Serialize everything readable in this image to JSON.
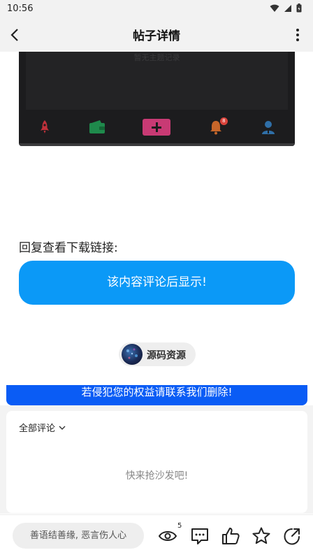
{
  "status": {
    "time": "10:56"
  },
  "appbar": {
    "title": "帖子详情"
  },
  "embed": {
    "ghost_text": "暂无主题记录",
    "tabs": [
      "rocket-icon",
      "wallet-icon",
      "add-icon",
      "bell-icon",
      "user-icon"
    ],
    "bell_badge": "8"
  },
  "post": {
    "reply_label": "回复查看下载链接:",
    "reveal_button": "该内容评论后显示!",
    "source_name": "源码资源",
    "notice": "若侵犯您的权益请联系我们删除!"
  },
  "comments": {
    "header": "全部评论",
    "empty_text": "快来抢沙发吧!"
  },
  "bottombar": {
    "input_placeholder": "善语结善缘, 恶言伤人心",
    "view_count": "5"
  },
  "colors": {
    "accent_blue": "#0b99f7",
    "notice_blue": "#0a5cf5"
  }
}
